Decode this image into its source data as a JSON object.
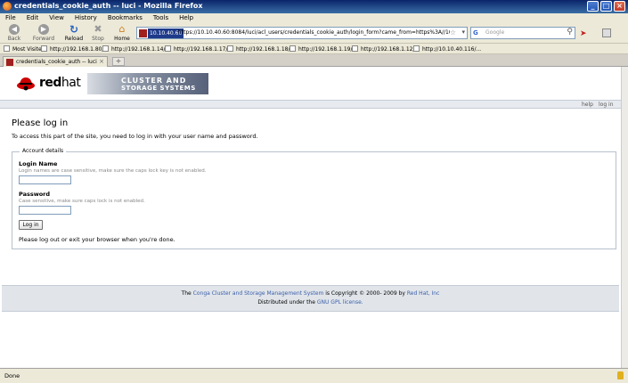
{
  "window": {
    "title": "credentials_cookie_auth -- luci - Mozilla Firefox",
    "controls": [
      "_",
      "□",
      "×"
    ]
  },
  "menu": [
    "File",
    "Edit",
    "View",
    "History",
    "Bookmarks",
    "Tools",
    "Help"
  ],
  "nav": {
    "back": "Back",
    "forward": "Forward",
    "reload": "Reload",
    "stop": "Stop",
    "home": "Home",
    "ip_badge": "10.10.40.60",
    "url": "https://10.10.40.60:8084/luci/acl_users/credentials_cookie_auth/login_form?came_from=https%3A//10.10.40.60%3A8084/luci/l",
    "search_engine": "G",
    "search_placeholder": "Google"
  },
  "bookmarks": [
    "Most Visited",
    "http://192.168.1.80/...",
    "http://192.168.1.14/...",
    "http://192.168.1.17/...",
    "http://192.168.1.18/...",
    "http://192.168.1.19/...",
    "http://192.168.1.12/...",
    "http://10.10.40.116/..."
  ],
  "tab": {
    "label": "credentials_cookie_auth -- luci",
    "close": "×",
    "new": "+"
  },
  "header": {
    "logo_word_bold": "red",
    "logo_word": "hat",
    "banner_line1": "CLUSTER AND",
    "banner_line2": "STORAGE SYSTEMS",
    "help": "help",
    "login": "log in"
  },
  "page": {
    "title": "Please log in",
    "intro": "To access this part of the site, you need to log in with your user name and password.",
    "legend": "Account details",
    "login_label": "Login Name",
    "login_help": "Login names are case sensitive, make sure the caps lock key is not enabled.",
    "password_label": "Password",
    "password_help": "Case sensitive, make sure caps lock is not enabled.",
    "button": "Log in",
    "note": "Please log out or exit your browser when you're done."
  },
  "footer": {
    "l1_pre": "The",
    "l1_link1": "Conga Cluster and Storage Management System",
    "l1_mid": "is Copyright © 2000- 2009 by",
    "l1_link2": "Red Hat, Inc",
    "l2_pre": "Distributed under the",
    "l2_link": "GNU GPL license."
  },
  "status": "Done",
  "colors": {
    "titlebar": "#0a246a",
    "link": "#3a5ea8",
    "redhat_red": "#cc0000"
  }
}
